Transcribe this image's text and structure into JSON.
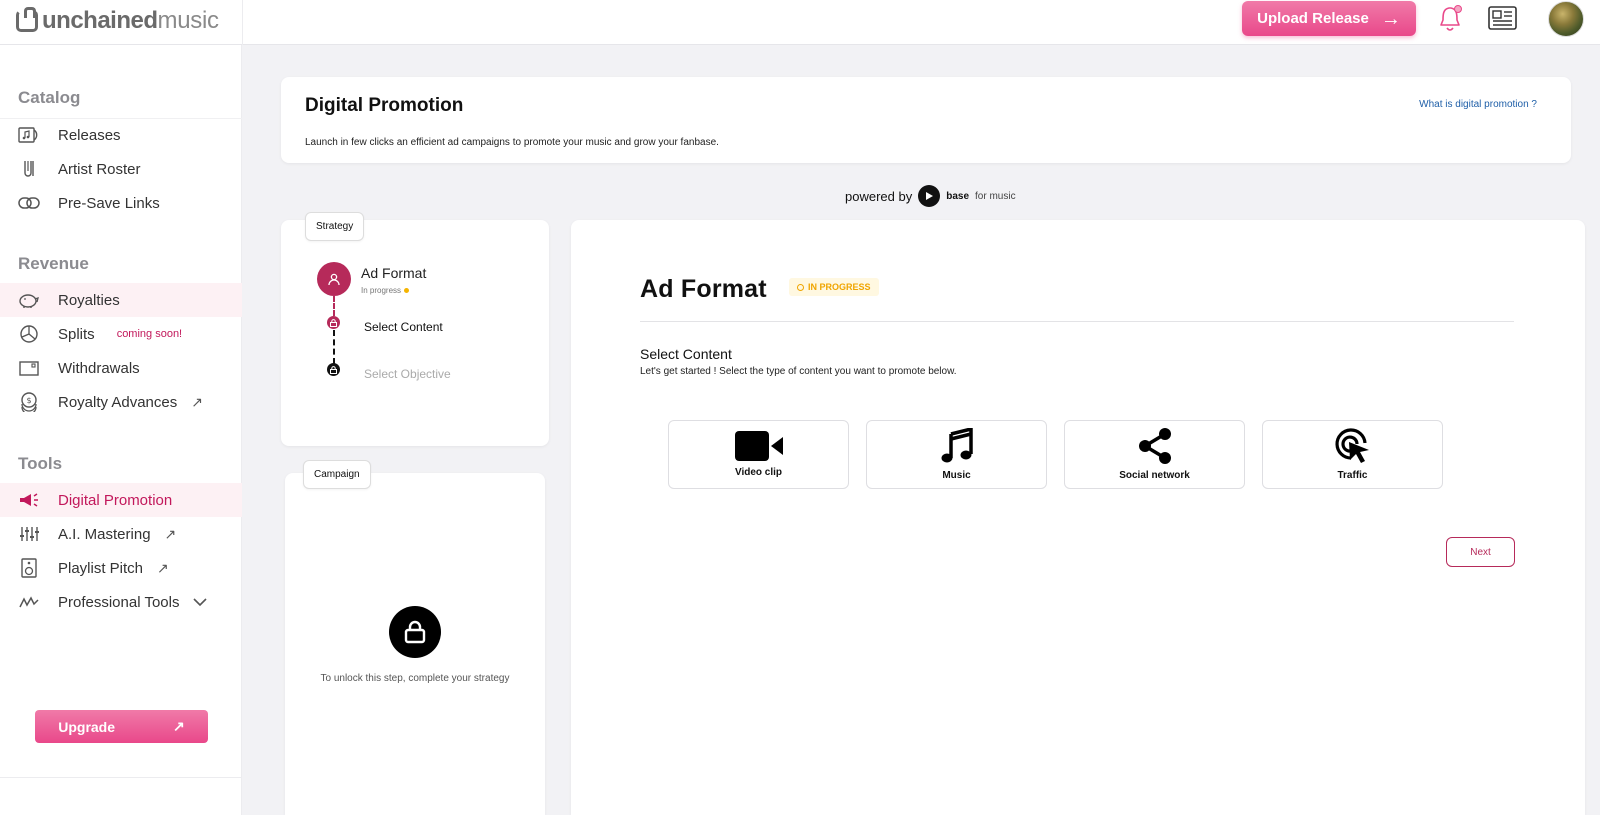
{
  "brand": {
    "logo_bold": "unchained",
    "logo_light": "music"
  },
  "topbar": {
    "upload_label": "Upload Release"
  },
  "sidebar": {
    "catalog_title": "Catalog",
    "catalog_items": [
      {
        "label": "Releases"
      },
      {
        "label": "Artist Roster"
      },
      {
        "label": "Pre-Save Links"
      }
    ],
    "revenue_title": "Revenue",
    "revenue_items": [
      {
        "label": "Royalties"
      },
      {
        "label": "Splits",
        "badge": "coming soon!"
      },
      {
        "label": "Withdrawals"
      },
      {
        "label": "Royalty Advances"
      }
    ],
    "tools_title": "Tools",
    "tools_items": [
      {
        "label": "Digital Promotion"
      },
      {
        "label": "A.I. Mastering"
      },
      {
        "label": "Playlist Pitch"
      },
      {
        "label": "Professional Tools"
      }
    ],
    "upgrade_label": "Upgrade"
  },
  "header": {
    "title": "Digital Promotion",
    "subtitle": "Launch in few clicks an efficient ad campaigns to promote your music and grow your fanbase.",
    "help_link": "What is digital promotion ?"
  },
  "powered": {
    "prefix": "powered by",
    "brand_bold": "base",
    "brand_light": "for music"
  },
  "strategy": {
    "tag": "Strategy",
    "step_title": "Ad Format",
    "step_status": "In progress",
    "sub_steps": [
      {
        "label": "Select Content"
      },
      {
        "label": "Select Objective"
      }
    ]
  },
  "campaign": {
    "tag": "Campaign",
    "locked_text": "To unlock this step, complete your strategy"
  },
  "main": {
    "title": "Ad Format",
    "status": "IN PROGRESS",
    "section_title": "Select Content",
    "section_desc": "Let's get started ! Select the type of content you want to promote below.",
    "options": [
      {
        "label": "Video clip",
        "icon": "video-camera-icon"
      },
      {
        "label": "Music",
        "icon": "music-note-icon"
      },
      {
        "label": "Social network",
        "icon": "share-icon"
      },
      {
        "label": "Traffic",
        "icon": "click-target-icon"
      }
    ],
    "next_label": "Next"
  },
  "colors": {
    "accent": "#e9488a",
    "brand_dark": "#b62a5a",
    "status": "#f0a500",
    "link": "#1f5fa8"
  }
}
